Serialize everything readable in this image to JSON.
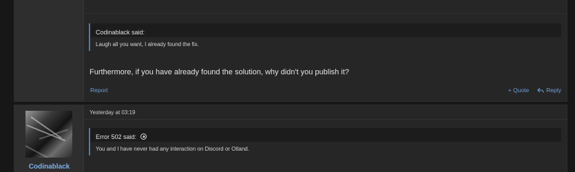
{
  "post1": {
    "quote": {
      "author_label": "Codinablack said:",
      "text": "Laugh all you want, I already found the fix."
    },
    "message": "Furthermore, if you have already found the solution, why didn't you publish it?",
    "report_label": "Report",
    "quote_label": "+ Quote",
    "reply_label": "Reply"
  },
  "post2": {
    "username": "Codinablack",
    "date": "Yesterday at 03:19",
    "quote": {
      "author_label": "Error 502 said:",
      "text": "You and I have never had any interaction on Discord or Otland."
    }
  },
  "colors": {
    "link": "#6f9fd8",
    "username": "#7fb0ea",
    "quote_border": "#4f7bb3",
    "background": "#171717",
    "panel": "#262626"
  }
}
